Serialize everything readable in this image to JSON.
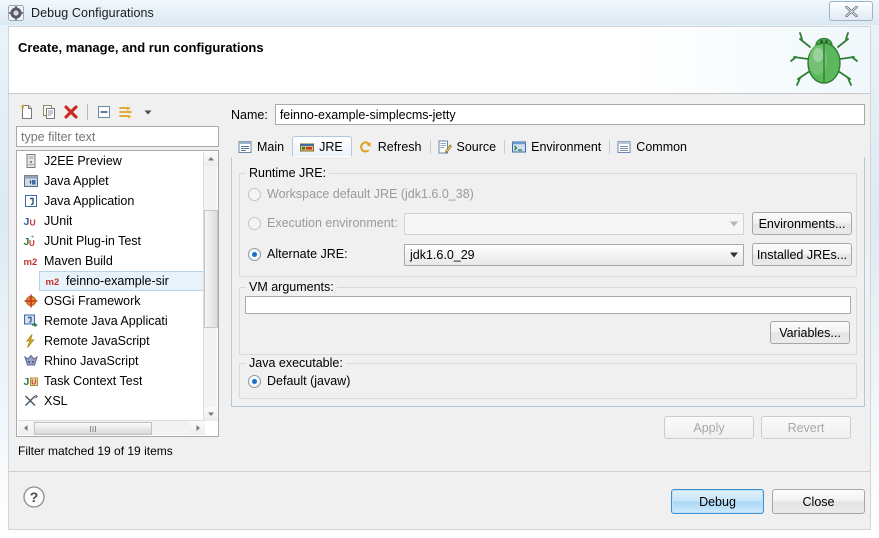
{
  "window": {
    "title": "Debug Configurations",
    "icon": "gear-icon",
    "close_label": "✕"
  },
  "header": {
    "title": "Create, manage, and run configurations",
    "image": "debug-bug-icon"
  },
  "left_panel": {
    "toolbar": [
      {
        "name": "new-configuration-button",
        "icon": "new-page-icon"
      },
      {
        "name": "duplicate-configuration-button",
        "icon": "copy-icon"
      },
      {
        "name": "delete-configuration-button",
        "icon": "red-x-icon"
      },
      {
        "name": "collapse-all-button",
        "icon": "collapse-all-icon"
      },
      {
        "name": "filter-configurations-button",
        "icon": "filter-icon"
      },
      {
        "name": "filter-dropdown-button",
        "icon": "chevron-down-icon"
      }
    ],
    "filter": {
      "value": "",
      "placeholder": "type filter text"
    },
    "tree": [
      {
        "label": "J2EE Preview",
        "icon": "j2ee-preview-icon",
        "child": false,
        "selected": false
      },
      {
        "label": "Java Applet",
        "icon": "java-applet-icon",
        "child": false,
        "selected": false
      },
      {
        "label": "Java Application",
        "icon": "java-application-icon",
        "child": false,
        "selected": false
      },
      {
        "label": "JUnit",
        "icon": "junit-icon",
        "child": false,
        "selected": false
      },
      {
        "label": "JUnit Plug-in Test",
        "icon": "junit-plugin-icon",
        "child": false,
        "selected": false
      },
      {
        "label": "Maven Build",
        "icon": "maven-icon",
        "child": false,
        "selected": false
      },
      {
        "label": "feinno-example-sir",
        "icon": "maven-icon",
        "child": true,
        "selected": true
      },
      {
        "label": "OSGi Framework",
        "icon": "osgi-icon",
        "child": false,
        "selected": false
      },
      {
        "label": "Remote Java Applicati",
        "icon": "remote-java-icon",
        "child": false,
        "selected": false
      },
      {
        "label": "Remote JavaScript",
        "icon": "remote-javascript-icon",
        "child": false,
        "selected": false
      },
      {
        "label": "Rhino JavaScript",
        "icon": "rhino-icon",
        "child": false,
        "selected": false
      },
      {
        "label": "Task Context Test",
        "icon": "task-context-icon",
        "child": false,
        "selected": false
      },
      {
        "label": "XSL",
        "icon": "xsl-icon",
        "child": false,
        "selected": false
      }
    ],
    "status": "Filter matched 19 of 19 items"
  },
  "right_panel": {
    "name_label": "Name:",
    "name_value": "feinno-example-simplecms-jetty",
    "tabs": [
      {
        "label": "Main",
        "icon": "main-tab-icon",
        "active": false
      },
      {
        "label": "JRE",
        "icon": "jre-tab-icon",
        "active": true
      },
      {
        "label": "Refresh",
        "icon": "refresh-tab-icon",
        "active": false
      },
      {
        "label": "Source",
        "icon": "source-tab-icon",
        "active": false
      },
      {
        "label": "Environment",
        "icon": "environment-tab-icon",
        "active": false
      },
      {
        "label": "Common",
        "icon": "common-tab-icon",
        "active": false
      }
    ],
    "runtime_jre": {
      "group_title": "Runtime JRE:",
      "workspace_default": {
        "label": "Workspace default JRE (jdk1.6.0_38)",
        "checked": false,
        "enabled": false
      },
      "execution_environment": {
        "label": "Execution environment:",
        "checked": false,
        "enabled": false,
        "combo_value": ""
      },
      "alternate_jre": {
        "label": "Alternate JRE:",
        "checked": true,
        "enabled": true,
        "combo_value": "jdk1.6.0_29"
      },
      "environments_button": "Environments...",
      "installed_jres_button": "Installed JREs..."
    },
    "vm_arguments": {
      "group_title": "VM arguments:",
      "value": "",
      "variables_button": "Variables..."
    },
    "java_executable": {
      "group_title": "Java executable:",
      "default_label": "Default (javaw)",
      "checked": true
    },
    "apply_button": "Apply",
    "revert_button": "Revert"
  },
  "footer": {
    "help_icon": "help-icon",
    "debug_button": "Debug",
    "close_button": "Close"
  },
  "colors": {
    "accent": "#1a6fc4",
    "default_button_border": "#3c8fd0",
    "delete_icon": "#c4342c",
    "maven_red": "#c4342c"
  }
}
